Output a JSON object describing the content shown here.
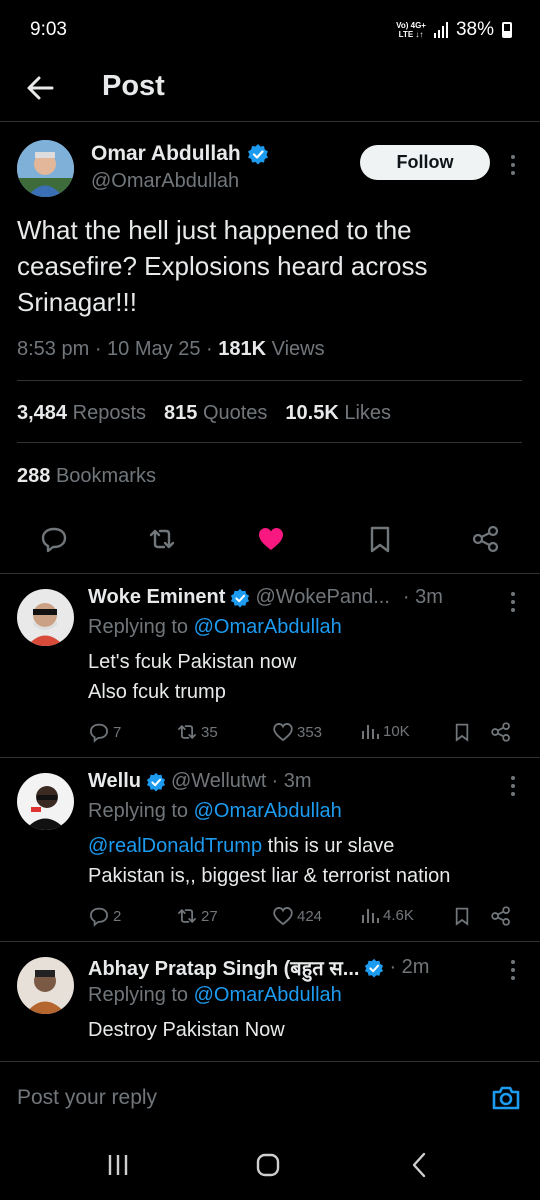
{
  "status_bar": {
    "time": "9:03",
    "network_top": "Vo) 4G+",
    "network_bottom": "LTE ↓↑",
    "battery": "38%"
  },
  "header": {
    "title": "Post",
    "back_icon": "arrow-left-icon"
  },
  "post": {
    "author_name": "Omar Abdullah",
    "author_handle": "@OmarAbdullah",
    "follow_label": "Follow",
    "text": "What the hell just happened to the ceasefire? Explosions heard across Srinagar!!!",
    "time": "8:53 pm",
    "date": "10 May 25",
    "views_count": "181K",
    "views_label": "Views",
    "reposts_count": "3,484",
    "reposts_label": "Reposts",
    "quotes_count": "815",
    "quotes_label": "Quotes",
    "likes_count": "10.5K",
    "likes_label": "Likes",
    "bookmarks_count": "288",
    "bookmarks_label": "Bookmarks",
    "liked": true,
    "accent_color": "#1d9bf0",
    "like_color": "#f91880"
  },
  "replies": [
    {
      "name": "Woke Eminent",
      "handle": "@WokePand...",
      "time": "· 3m",
      "replying_prefix": "Replying to",
      "replying_to": "@OmarAbdullah",
      "text_line1": "Let's fcuk Pakistan now",
      "text_line2": "Also fcuk trump",
      "comments": "7",
      "reposts": "35",
      "likes": "353",
      "views": "10K"
    },
    {
      "name": "Wellu",
      "handle": "@Wellutwt",
      "time": "· 3m",
      "replying_prefix": "Replying to",
      "replying_to": "@OmarAbdullah",
      "text_mention": "@realDonaldTrump",
      "text_line1_rest": " this is ur slave",
      "text_line2": "Pakistan is,, biggest liar & terrorist nation",
      "comments": "2",
      "reposts": "27",
      "likes": "424",
      "views": "4.6K"
    },
    {
      "name": "Abhay Pratap Singh (बहुत स...",
      "handle": "",
      "time": "· 2m",
      "replying_prefix": "Replying to",
      "replying_to": "@OmarAbdullah",
      "text_line1": "Destroy Pakistan Now"
    }
  ],
  "composer": {
    "placeholder": "Post your reply"
  }
}
